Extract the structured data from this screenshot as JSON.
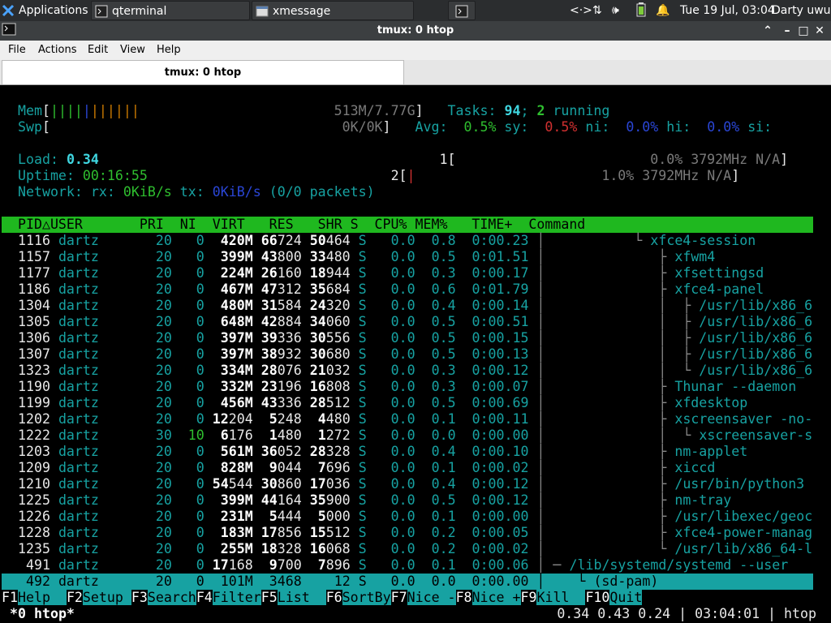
{
  "panel": {
    "apps_label": "Applications",
    "tab1": "qterminal",
    "tab2": "xmessage",
    "clock": "Tue 19 Jul, 03:04",
    "user": "Darty uwu"
  },
  "window": {
    "title": "tmux: 0 htop"
  },
  "menu": [
    "File",
    "Actions",
    "Edit",
    "View",
    "Help"
  ],
  "tab": {
    "label": "tmux: 0 htop"
  },
  "meters": {
    "mem_label": "Mem",
    "mem_value": "513M/7.77G",
    "swp_label": "Swp",
    "swp_value": "0K/0K",
    "tasks_label": "Tasks: ",
    "tasks": "94",
    "running": "2",
    "running_label": " running",
    "avg_label": "Avg:",
    "avg": "0.5%",
    "sy_label": "sy:",
    "sy": "0.5%",
    "ni_label": "ni:",
    "ni": "0.0%",
    "hi_label": "hi:",
    "hi": "0.0%",
    "si_label": "si:",
    "load_label": "Load: ",
    "load": "0.34",
    "uptime_label": "Uptime: ",
    "uptime": "00:16:55",
    "net_label": "Network: rx: ",
    "rx": "0KiB/s",
    "tx_label": " tx: ",
    "tx": "0KiB/s",
    "packets": " (0/0 packets)",
    "cpu1_label": "1",
    "cpu1": "0.0% 3792MHz N/A",
    "cpu2_label": "2",
    "cpu2": "1.0% 3792MHz N/A"
  },
  "columns": "  PID△USER       PRI  NI  VIRT   RES   SHR S  CPU% MEM%   TIME+  Command",
  "processes": [
    {
      "pid": "1116",
      "user": "dartz",
      "pri": "20",
      "ni": "0",
      "virt": "420M",
      "res": "66724",
      "shr": "50464",
      "s": "S",
      "cpu": "0.0",
      "mem": "0.8",
      "time": "0:00.23",
      "tree": "           └ ",
      "cmd": "xfce4-session"
    },
    {
      "pid": "1157",
      "user": "dartz",
      "pri": "20",
      "ni": "0",
      "virt": "399M",
      "res": "43800",
      "shr": "33480",
      "s": "S",
      "cpu": "0.0",
      "mem": "0.5",
      "time": "0:01.51",
      "tree": "              ├ ",
      "cmd": "xfwm4"
    },
    {
      "pid": "1177",
      "user": "dartz",
      "pri": "20",
      "ni": "0",
      "virt": "224M",
      "res": "26160",
      "shr": "18944",
      "s": "S",
      "cpu": "0.0",
      "mem": "0.3",
      "time": "0:00.17",
      "tree": "              ├ ",
      "cmd": "xfsettingsd"
    },
    {
      "pid": "1186",
      "user": "dartz",
      "pri": "20",
      "ni": "0",
      "virt": "467M",
      "res": "47312",
      "shr": "35684",
      "s": "S",
      "cpu": "0.0",
      "mem": "0.6",
      "time": "0:01.79",
      "tree": "              ├ ",
      "cmd": "xfce4-panel"
    },
    {
      "pid": "1304",
      "user": "dartz",
      "pri": "20",
      "ni": "0",
      "virt": "480M",
      "res": "31584",
      "shr": "24320",
      "s": "S",
      "cpu": "0.0",
      "mem": "0.4",
      "time": "0:00.14",
      "tree": "              │  ├ ",
      "cmd": "/usr/lib/x86_6"
    },
    {
      "pid": "1305",
      "user": "dartz",
      "pri": "20",
      "ni": "0",
      "virt": "648M",
      "res": "42884",
      "shr": "34060",
      "s": "S",
      "cpu": "0.0",
      "mem": "0.5",
      "time": "0:00.51",
      "tree": "              │  ├ ",
      "cmd": "/usr/lib/x86_6"
    },
    {
      "pid": "1306",
      "user": "dartz",
      "pri": "20",
      "ni": "0",
      "virt": "397M",
      "res": "39336",
      "shr": "30556",
      "s": "S",
      "cpu": "0.0",
      "mem": "0.5",
      "time": "0:00.15",
      "tree": "              │  ├ ",
      "cmd": "/usr/lib/x86_6"
    },
    {
      "pid": "1307",
      "user": "dartz",
      "pri": "20",
      "ni": "0",
      "virt": "397M",
      "res": "38932",
      "shr": "30680",
      "s": "S",
      "cpu": "0.0",
      "mem": "0.5",
      "time": "0:00.13",
      "tree": "              │  ├ ",
      "cmd": "/usr/lib/x86_6"
    },
    {
      "pid": "1323",
      "user": "dartz",
      "pri": "20",
      "ni": "0",
      "virt": "334M",
      "res": "28076",
      "shr": "21032",
      "s": "S",
      "cpu": "0.0",
      "mem": "0.3",
      "time": "0:00.12",
      "tree": "              │  └ ",
      "cmd": "/usr/lib/x86_6"
    },
    {
      "pid": "1190",
      "user": "dartz",
      "pri": "20",
      "ni": "0",
      "virt": "332M",
      "res": "23196",
      "shr": "16808",
      "s": "S",
      "cpu": "0.0",
      "mem": "0.3",
      "time": "0:00.07",
      "tree": "              ├ ",
      "cmd": "Thunar --daemon"
    },
    {
      "pid": "1199",
      "user": "dartz",
      "pri": "20",
      "ni": "0",
      "virt": "456M",
      "res": "43336",
      "shr": "28512",
      "s": "S",
      "cpu": "0.0",
      "mem": "0.5",
      "time": "0:00.69",
      "tree": "              ├ ",
      "cmd": "xfdesktop"
    },
    {
      "pid": "1202",
      "user": "dartz",
      "pri": "20",
      "ni": "0",
      "virt": "12204",
      "res": "5248",
      "shr": "4480",
      "s": "S",
      "cpu": "0.0",
      "mem": "0.1",
      "time": "0:00.11",
      "tree": "              ├ ",
      "cmd": "xscreensaver -no-"
    },
    {
      "pid": "1222",
      "user": "dartz",
      "pri": "30",
      "ni": "10",
      "virt": "6176",
      "res": "1480",
      "shr": "1272",
      "s": "S",
      "cpu": "0.0",
      "mem": "0.0",
      "time": "0:00.00",
      "tree": "              │  └ ",
      "cmd": "xscreensaver-s"
    },
    {
      "pid": "1203",
      "user": "dartz",
      "pri": "20",
      "ni": "0",
      "virt": "561M",
      "res": "36052",
      "shr": "28328",
      "s": "S",
      "cpu": "0.0",
      "mem": "0.4",
      "time": "0:00.10",
      "tree": "              ├ ",
      "cmd": "nm-applet"
    },
    {
      "pid": "1209",
      "user": "dartz",
      "pri": "20",
      "ni": "0",
      "virt": "828M",
      "res": "9044",
      "shr": "7696",
      "s": "S",
      "cpu": "0.0",
      "mem": "0.1",
      "time": "0:00.02",
      "tree": "              ├ ",
      "cmd": "xiccd"
    },
    {
      "pid": "1210",
      "user": "dartz",
      "pri": "20",
      "ni": "0",
      "virt": "54544",
      "res": "30860",
      "shr": "17036",
      "s": "S",
      "cpu": "0.0",
      "mem": "0.4",
      "time": "0:00.12",
      "tree": "              ├ ",
      "cmd": "/usr/bin/python3"
    },
    {
      "pid": "1225",
      "user": "dartz",
      "pri": "20",
      "ni": "0",
      "virt": "399M",
      "res": "44164",
      "shr": "35900",
      "s": "S",
      "cpu": "0.0",
      "mem": "0.5",
      "time": "0:00.12",
      "tree": "              ├ ",
      "cmd": "nm-tray"
    },
    {
      "pid": "1226",
      "user": "dartz",
      "pri": "20",
      "ni": "0",
      "virt": "231M",
      "res": "5444",
      "shr": "5000",
      "s": "S",
      "cpu": "0.0",
      "mem": "0.1",
      "time": "0:00.00",
      "tree": "              ├ ",
      "cmd": "/usr/libexec/geoc"
    },
    {
      "pid": "1228",
      "user": "dartz",
      "pri": "20",
      "ni": "0",
      "virt": "183M",
      "res": "17856",
      "shr": "15512",
      "s": "S",
      "cpu": "0.0",
      "mem": "0.2",
      "time": "0:00.05",
      "tree": "              ├ ",
      "cmd": "xfce4-power-manag"
    },
    {
      "pid": "1235",
      "user": "dartz",
      "pri": "20",
      "ni": "0",
      "virt": "255M",
      "res": "18328",
      "shr": "16068",
      "s": "S",
      "cpu": "0.0",
      "mem": "0.2",
      "time": "0:00.02",
      "tree": "              └ ",
      "cmd": "/usr/lib/x86_64-l"
    },
    {
      "pid": "491",
      "user": "dartz",
      "pri": "20",
      "ni": "0",
      "virt": "17168",
      "res": "9700",
      "shr": "7896",
      "s": "S",
      "cpu": "0.0",
      "mem": "0.1",
      "time": "0:00.06",
      "tree": " ─ ",
      "cmd": "/lib/systemd/systemd --user"
    },
    {
      "pid": "492",
      "user": "dartz",
      "pri": "20",
      "ni": "0",
      "virt": "101M",
      "res": "3468",
      "shr": "12",
      "s": "S",
      "cpu": "0.0",
      "mem": "0.0",
      "time": "0:00.00",
      "tree": "    └ ",
      "cmd": "(sd-pam)"
    }
  ],
  "fkeys": [
    {
      "key": "F1",
      "label": "Help  "
    },
    {
      "key": "F2",
      "label": "Setup "
    },
    {
      "key": "F3",
      "label": "Search"
    },
    {
      "key": "F4",
      "label": "Filter"
    },
    {
      "key": "F5",
      "label": "List  "
    },
    {
      "key": "F6",
      "label": "SortBy"
    },
    {
      "key": "F7",
      "label": "Nice -"
    },
    {
      "key": "F8",
      "label": "Nice +"
    },
    {
      "key": "F9",
      "label": "Kill  "
    },
    {
      "key": "F10",
      "label": "Quit"
    }
  ],
  "tmux": {
    "window": "*0 htop*",
    "status": "0.34 0.43 0.24 | 03:04:01 | htop "
  }
}
